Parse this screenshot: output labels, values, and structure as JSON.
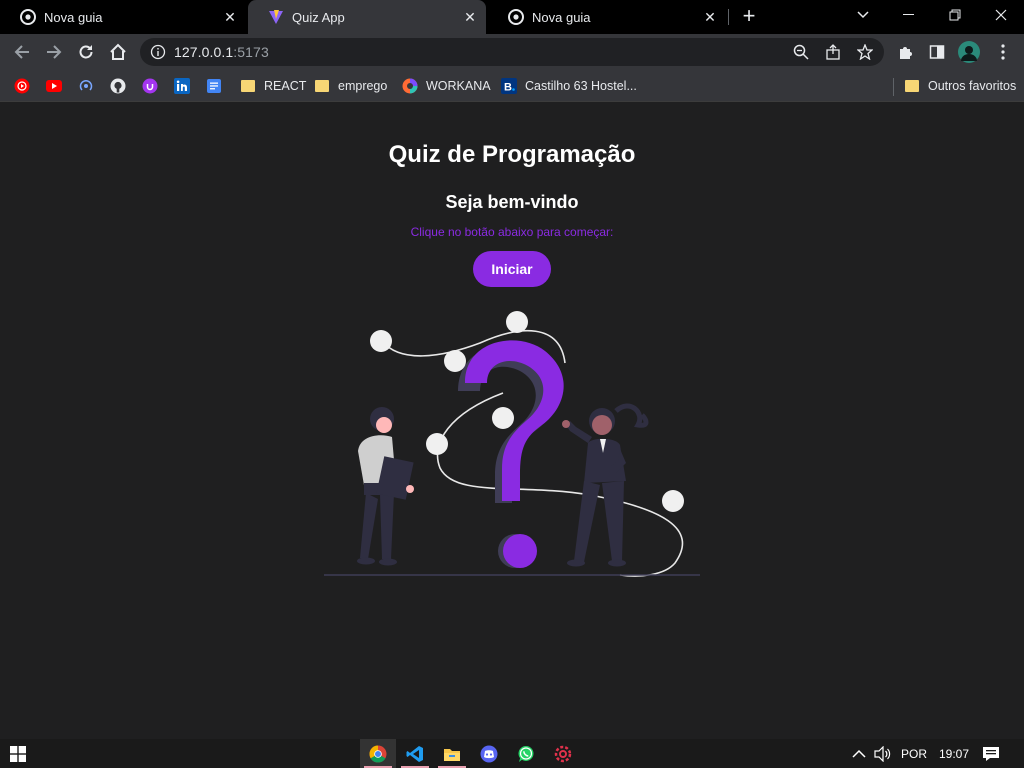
{
  "tabs": [
    {
      "title": "Nova guia",
      "icon": "chrome-icon",
      "active": false
    },
    {
      "title": "Quiz App",
      "icon": "vite-icon",
      "active": true
    },
    {
      "title": "Nova guia",
      "icon": "chrome-icon",
      "active": false
    }
  ],
  "toolbar": {
    "url_host": "127.0.0.1",
    "url_port": ":5173"
  },
  "bookmarks": [
    {
      "label": "",
      "icon": "youtube-music-icon"
    },
    {
      "label": "",
      "icon": "youtube-icon"
    },
    {
      "label": "",
      "icon": "podcast-icon"
    },
    {
      "label": "",
      "icon": "github-icon"
    },
    {
      "label": "",
      "icon": "udemy-icon"
    },
    {
      "label": "",
      "icon": "linkedin-icon"
    },
    {
      "label": "",
      "icon": "docs-icon"
    },
    {
      "label": "REACT",
      "icon": "folder-icon"
    },
    {
      "label": "emprego",
      "icon": "folder-icon"
    },
    {
      "label": "WORKANA",
      "icon": "workana-icon"
    },
    {
      "label": "Castilho 63 Hostel...",
      "icon": "booking-icon"
    }
  ],
  "other_bookmarks": "Outros favoritos",
  "page": {
    "title": "Quiz de Programação",
    "subtitle": "Seja bem-vindo",
    "hint": "Clique no botão abaixo para começar:",
    "start_button": "Iniciar"
  },
  "colors": {
    "accent": "#8a2be2",
    "background": "#1f1f20"
  },
  "taskbar": {
    "apps": [
      "chrome-icon",
      "vscode-icon",
      "file-explorer-icon",
      "discord-icon",
      "whatsapp-icon",
      "settings-icon"
    ],
    "language": "POR",
    "time": "19:07"
  }
}
